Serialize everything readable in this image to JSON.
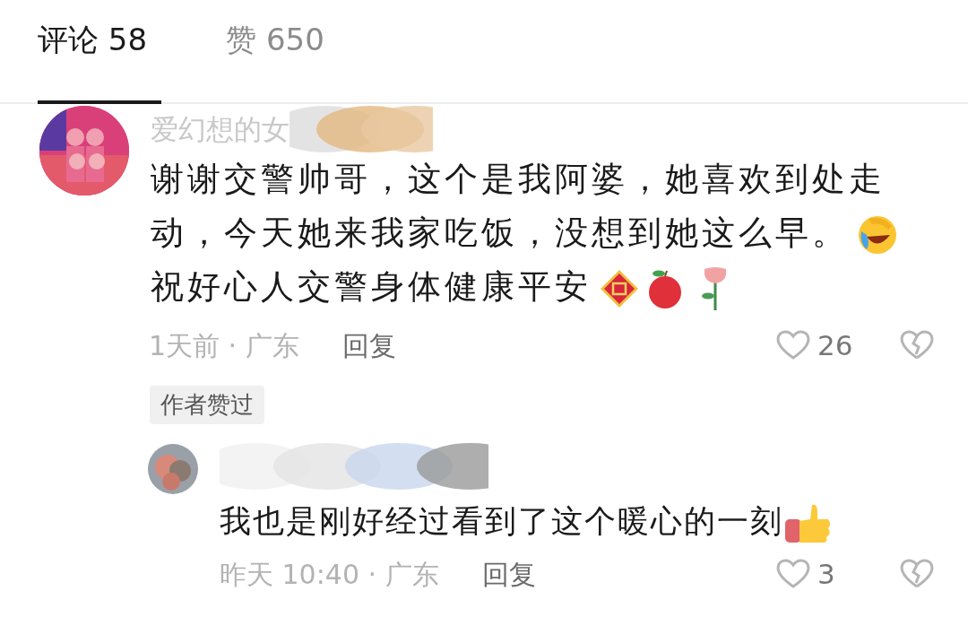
{
  "tabs": [
    {
      "label": "评论 58",
      "selected": true
    },
    {
      "label": "赞 650",
      "selected": false
    }
  ],
  "comments": [
    {
      "author": "爱幻想的女",
      "body": [
        {
          "kind": "text",
          "text": "谢谢交警帅哥，这个是我阿婆，她喜欢到处走动，今天她来我家吃饭，没想到她这么早。"
        },
        {
          "kind": "icon"
        },
        {
          "kind": "text",
          "text": "祝好心人交警身体健康平安"
        },
        {
          "kind": "icon"
        },
        {
          "kind": "icon"
        },
        {
          "kind": "icon"
        }
      ],
      "time": "1天前 · 广东",
      "reply": "回复",
      "likes": "26",
      "badge": "作者赞过",
      "replies": [
        {
          "body": [
            {
              "kind": "text",
              "text": "我也是刚好经过看到了这个暖心的一刻"
            },
            {
              "kind": "icon"
            }
          ],
          "time": "昨天 10:40 · 广东",
          "reply": "回复",
          "likes": "3"
        }
      ]
    }
  ]
}
